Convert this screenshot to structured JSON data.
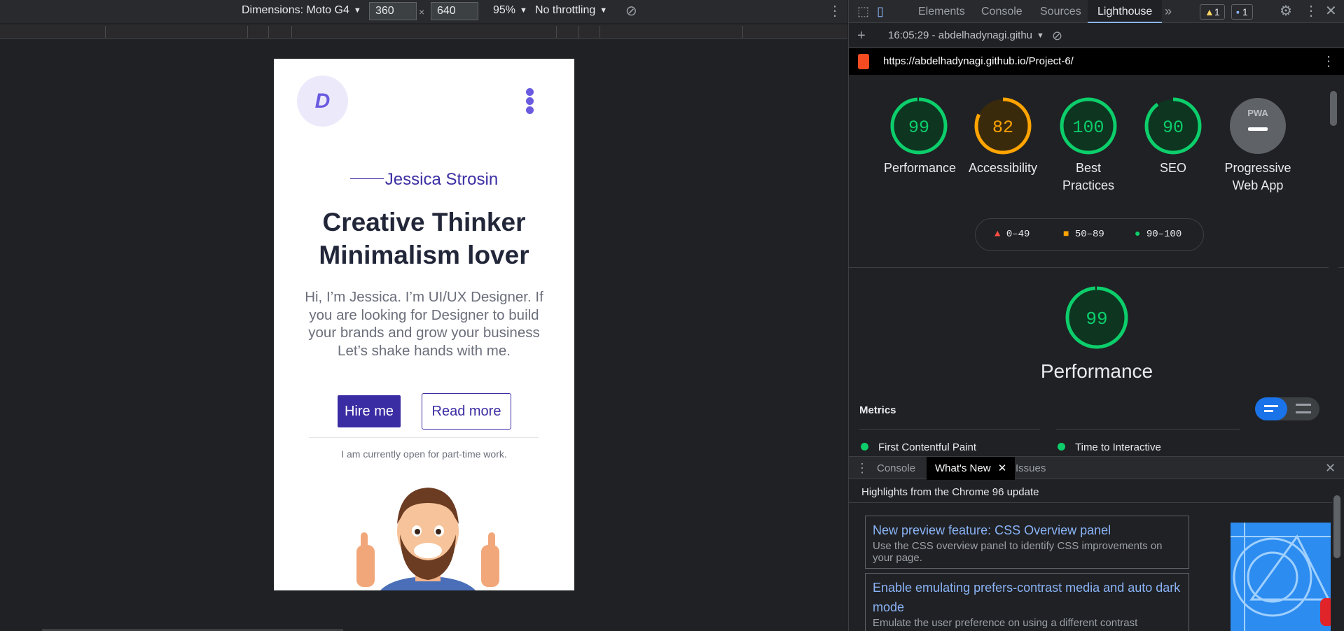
{
  "device_toolbar": {
    "dimensions_label": "Dimensions: Moto G4",
    "width": "360",
    "height": "640",
    "times": "×",
    "zoom": "95%",
    "throttling": "No throttling"
  },
  "page": {
    "logo_letter": "D",
    "name": "Jessica Strosin",
    "headline_line1": "Creative Thinker",
    "headline_line2": "Minimalism lover",
    "intro": "Hi, I’m Jessica. I’m UI/UX Designer. If you are looking for Designer to build your brands and grow your business Let’s shake hands with me.",
    "hire_label": "Hire me",
    "read_more_label": "Read more",
    "open_text": "I am currently open for part-time work."
  },
  "devtools": {
    "tabs": [
      "Elements",
      "Console",
      "Sources",
      "Lighthouse"
    ],
    "more_tabs": "»",
    "warnings_count": "1",
    "messages_count": "1",
    "report_selector": "16:05:29 - abdelhadynagi.githu",
    "url": "https://abdelhadynagi.github.io/Project-6/",
    "colors": {
      "pass": "#0cce6b",
      "average": "#ffa400",
      "fail": "#ff4e42",
      "accent": "#1a73e8"
    }
  },
  "lighthouse": {
    "scores": [
      {
        "label": "Performance",
        "value": "99",
        "score": 99,
        "status": "pass"
      },
      {
        "label": "Accessibility",
        "value": "82",
        "score": 82,
        "status": "average"
      },
      {
        "label": "Best Practices",
        "value": "100",
        "score": 100,
        "status": "pass"
      },
      {
        "label": "SEO",
        "value": "90",
        "score": 90,
        "status": "pass"
      },
      {
        "label": "Progressive Web App",
        "value": "PWA",
        "status": "na"
      }
    ],
    "legend": [
      "0–49",
      "50–89",
      "90–100"
    ],
    "performance_score": "99",
    "performance_title": "Performance",
    "metrics_title": "Metrics",
    "metrics": [
      "First Contentful Paint",
      "Time to Interactive"
    ]
  },
  "drawer": {
    "tabs": [
      "Console",
      "What's New",
      "Issues"
    ],
    "highlights": "Highlights from the Chrome 96 update",
    "cards": [
      {
        "title": "New preview feature: CSS Overview panel",
        "desc": "Use the CSS overview panel to identify CSS improvements on your page."
      },
      {
        "title": "Enable emulating prefers-contrast media and auto dark mode",
        "desc": "Emulate the user preference on using a different contrast"
      }
    ]
  }
}
